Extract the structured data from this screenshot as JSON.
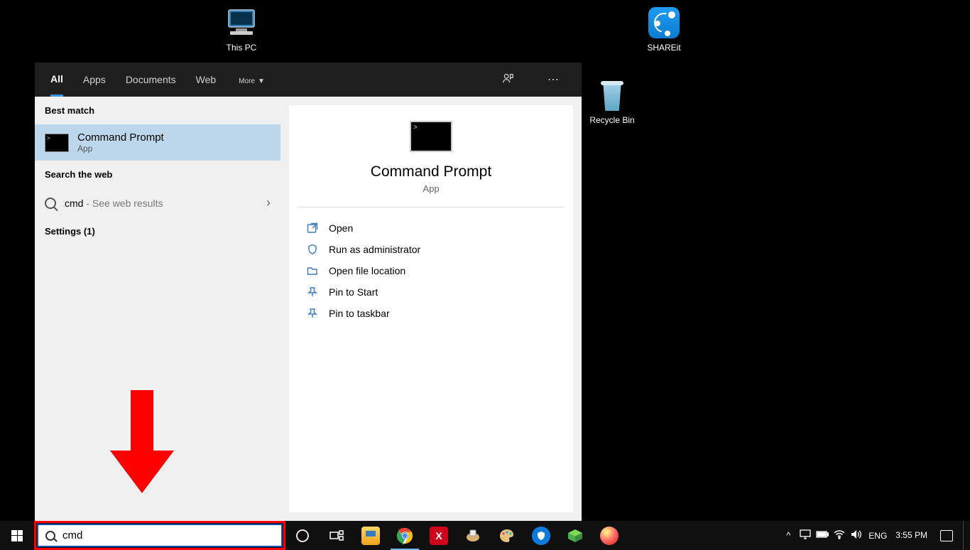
{
  "desktop": {
    "this_pc": "This PC",
    "shareit": "SHAREit",
    "recycle_bin": "Recycle Bin"
  },
  "search": {
    "tabs": {
      "all": "All",
      "apps": "Apps",
      "documents": "Documents",
      "web": "Web",
      "more": "More"
    },
    "headings": {
      "best_match": "Best match",
      "search_web": "Search the web",
      "settings": "Settings (1)"
    },
    "best_match": {
      "title": "Command Prompt",
      "subtitle": "App"
    },
    "web": {
      "query": "cmd",
      "suffix": " - See web results"
    },
    "preview": {
      "title": "Command Prompt",
      "subtitle": "App"
    },
    "actions": {
      "open": "Open",
      "run_admin": "Run as administrator",
      "open_file_loc": "Open file location",
      "pin_start": "Pin to Start",
      "pin_taskbar": "Pin to taskbar"
    },
    "input_value": "cmd"
  },
  "tray": {
    "lang": "ENG",
    "time": "3:55 PM"
  }
}
